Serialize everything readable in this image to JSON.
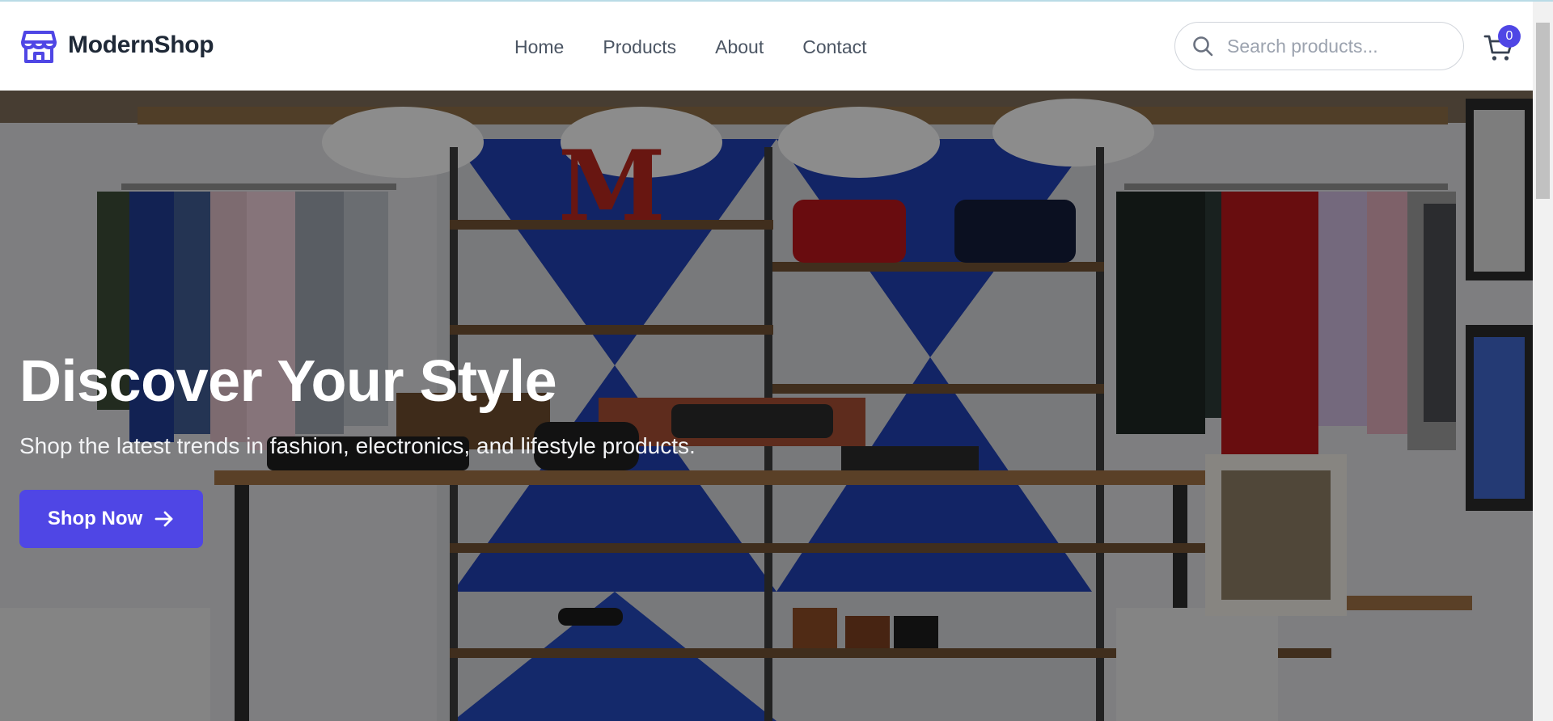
{
  "brand": {
    "name": "ModernShop",
    "icon": "storefront-icon",
    "color": "#4f46e5"
  },
  "nav": {
    "items": [
      {
        "label": "Home"
      },
      {
        "label": "Products"
      },
      {
        "label": "About"
      },
      {
        "label": "Contact"
      }
    ]
  },
  "search": {
    "placeholder": "Search products...",
    "value": "",
    "icon": "search-icon"
  },
  "cart": {
    "icon": "shopping-cart-icon",
    "count": "0"
  },
  "hero": {
    "title": "Discover Your Style",
    "subtitle": "Shop the latest trends in fashion, electronics, and lifestyle products.",
    "cta_label": "Shop Now",
    "cta_icon": "arrow-right-icon",
    "background": "clothing-store-interior-photo"
  },
  "colors": {
    "accent": "#4f46e5",
    "text_dark": "#1f2937",
    "nav_text": "#4b5563"
  }
}
